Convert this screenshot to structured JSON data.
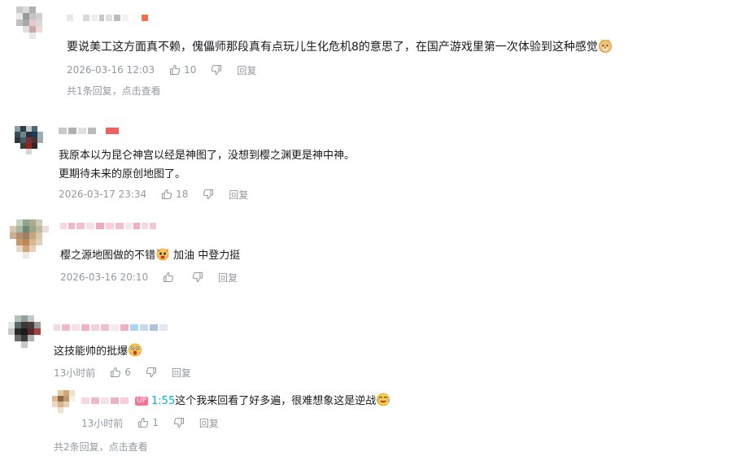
{
  "comments": [
    {
      "text": "要说美工这方面真不赖，傀儡师那段真有点玩儿生化危机8的意思了，在国产游戏里第一次体验到这种感觉",
      "time": "2026-03-16 12:03",
      "likes": "10",
      "reply_label": "回复",
      "footer": "共1条回复，点击查看",
      "emoji": "doge-emoji"
    },
    {
      "text_line1": "我原本以为昆仑神宫以经是神图了，没想到樱之渊更是神中神。",
      "text_line2": "更期待未来的原创地图了。",
      "time": "2026-03-17 23:34",
      "likes": "18",
      "reply_label": "回复"
    },
    {
      "text_before": "樱之源地图做的不错",
      "text_after": " 加油 中登力挺",
      "time": "2026-03-16 20:10",
      "likes": "",
      "reply_label": "回复",
      "emoji": "cheer-emoji"
    },
    {
      "text": "这技能帅的批爆",
      "time": "13小时前",
      "likes": "6",
      "reply_label": "回复",
      "emoji": "shocked-emoji",
      "sub_reply": {
        "badge": "UP",
        "timestamp": "1:55",
        "text": "这个我来回看了好多遍，很难想象这是逆战",
        "time": "13小时前",
        "likes": "1",
        "reply_label": "回复",
        "emoji": "laugh-emoji"
      },
      "footer": "共2条回复，点击查看"
    }
  ],
  "colors": {
    "text": "#18191c",
    "meta": "#9499a0",
    "link": "#00aeec",
    "up_badge": "#fb7299"
  }
}
